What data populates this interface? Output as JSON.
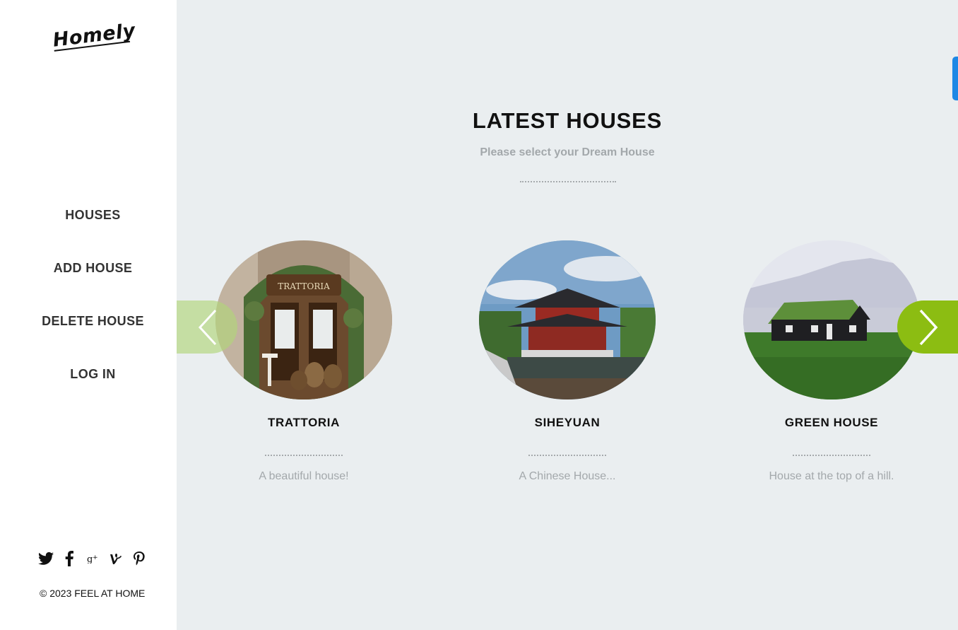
{
  "brand": {
    "logo": "Homely"
  },
  "nav": {
    "items": [
      {
        "label": "HOUSES"
      },
      {
        "label": "ADD HOUSE"
      },
      {
        "label": "DELETE HOUSE"
      },
      {
        "label": "LOG IN"
      }
    ]
  },
  "social": {
    "icons": [
      "twitter-icon",
      "facebook-icon",
      "google-plus-icon",
      "vine-icon",
      "pinterest-icon"
    ]
  },
  "footer": {
    "copyright": "© 2023 FEEL AT HOME"
  },
  "section": {
    "title": "LATEST HOUSES",
    "subtitle": "Please select your Dream House"
  },
  "houses": [
    {
      "title": "TRATTORIA",
      "description": "A beautiful house!",
      "sign": "TRATTORIA"
    },
    {
      "title": "SIHEYUAN",
      "description": "A Chinese House..."
    },
    {
      "title": "GREEN HOUSE",
      "description": "House at the top of a hill."
    }
  ],
  "colors": {
    "accent_green": "#8cbd12",
    "scroll_tab_blue": "#1e88e5",
    "main_background": "#eaeef0"
  }
}
